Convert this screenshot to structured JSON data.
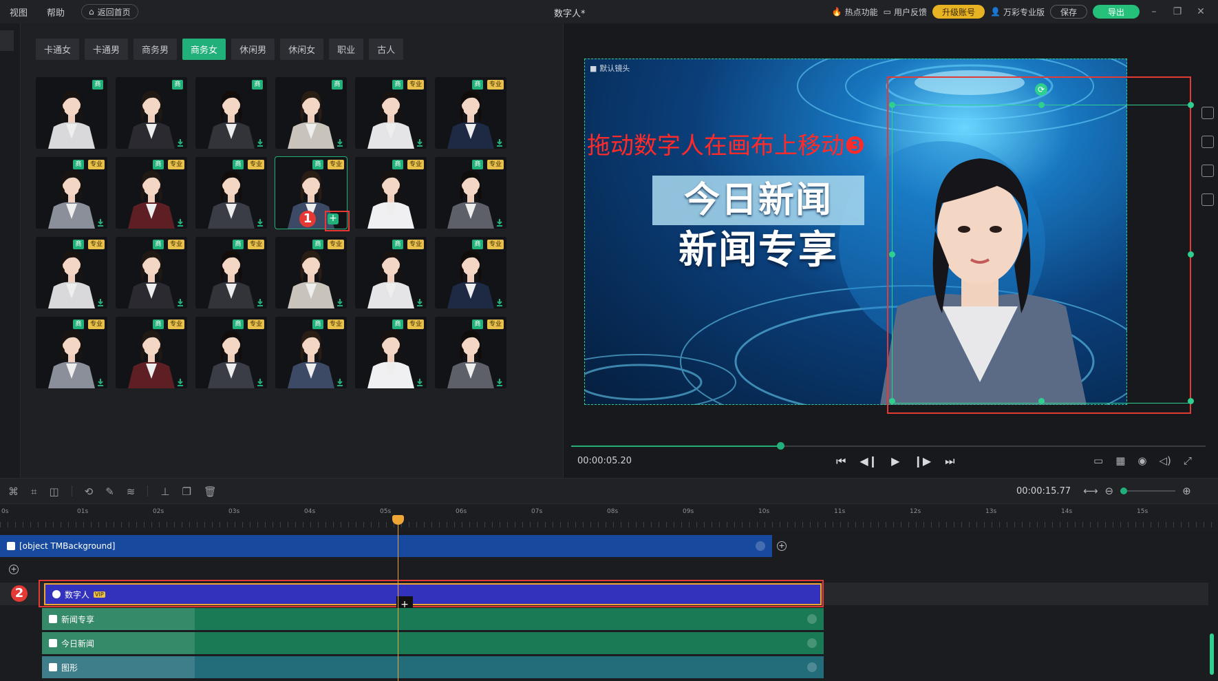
{
  "menu": {
    "view": "视图",
    "help": "帮助",
    "home": "返回首页"
  },
  "title": "数字人*",
  "right": {
    "hot": "热点功能",
    "feedback": "用户反馈",
    "upgrade": "升级账号",
    "edition": "万彩专业版",
    "save": "保存",
    "export": "导出"
  },
  "tabs": [
    "卡通女",
    "卡通男",
    "商务男",
    "商务女",
    "休闲男",
    "休闲女",
    "职业",
    "古人"
  ],
  "active_tab": "商务女",
  "badges": {
    "shang": "商",
    "pro": "专业"
  },
  "avatars": [
    {
      "pro": false
    },
    {
      "pro": false
    },
    {
      "pro": false
    },
    {
      "pro": false
    },
    {
      "pro": true
    },
    {
      "pro": true
    },
    {
      "pro": true
    },
    {
      "pro": true
    },
    {
      "pro": true
    },
    {
      "pro": true
    },
    {
      "pro": true
    },
    {
      "pro": true
    },
    {
      "pro": true
    },
    {
      "pro": true
    },
    {
      "pro": true
    },
    {
      "pro": true
    },
    {
      "pro": true
    },
    {
      "pro": true
    },
    {
      "pro": true
    },
    {
      "pro": true
    },
    {
      "pro": true
    },
    {
      "pro": true
    },
    {
      "pro": true
    },
    {
      "pro": true
    }
  ],
  "steps": {
    "one": "1",
    "two": "2",
    "three": "3"
  },
  "canvas": {
    "camera_label": "默认镜头",
    "headline1": "今日新闻",
    "headline2": "新闻专享",
    "drag_hint": "拖动数字人在画布上移动❸"
  },
  "player": {
    "current_time": "00:00:05.20",
    "progress": 0.33
  },
  "timeline": {
    "total_time": "00:00:15.77",
    "ticks": [
      "0s",
      "01s",
      "02s",
      "03s",
      "04s",
      "05s",
      "06s",
      "07s",
      "08s",
      "09s",
      "10s",
      "11s",
      "12s",
      "13s",
      "14s",
      "15s"
    ],
    "tracks": {
      "background": "[object TMBackground]",
      "digital_human": "数字人",
      "vip": "VIP",
      "text1": "新闻专享",
      "text2": "今日新闻",
      "shape": "图形"
    }
  },
  "colors": {
    "accent": "#22b07a",
    "warning": "#e8b323",
    "callout": "#e53935",
    "playhead": "#f0a637"
  }
}
